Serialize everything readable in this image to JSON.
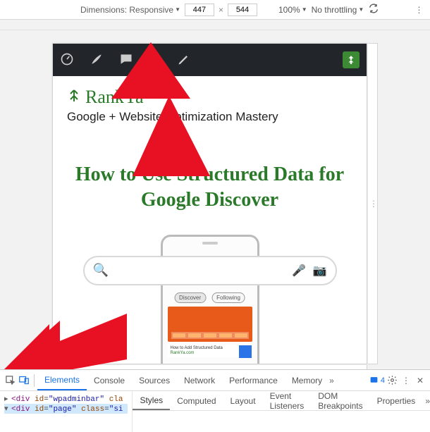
{
  "device_toolbar": {
    "dim_label": "Dimensions: Responsive",
    "width": "447",
    "height": "544",
    "zoom": "100%",
    "throttle": "No throttling"
  },
  "page": {
    "brand_name": "RankYa",
    "tagline": "Google + Website Optimization Mastery",
    "article_title": "How to Use Structured Data for Google Discover",
    "tabs": {
      "discover": "Discover",
      "following": "Following"
    },
    "card_caption": "How to Add Structured Data",
    "card_site": "RankYa.com"
  },
  "devtools": {
    "main_tabs": [
      "Elements",
      "Console",
      "Sources",
      "Network",
      "Performance",
      "Memory"
    ],
    "issues_count": "4",
    "sub_tabs": [
      "Styles",
      "Computed",
      "Layout",
      "Event Listeners",
      "DOM Breakpoints",
      "Properties"
    ],
    "dom": {
      "row1": {
        "id": "wpadminbar",
        "cls_prefix": "cla"
      },
      "row2": {
        "id": "page",
        "cls_prefix": "si"
      }
    }
  }
}
